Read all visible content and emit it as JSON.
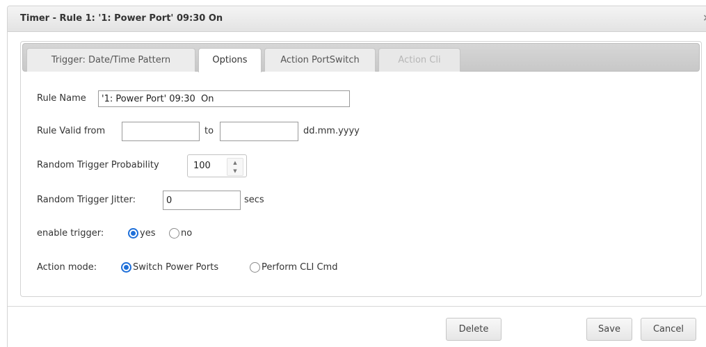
{
  "dialog": {
    "title": "Timer - Rule 1: '1: Power Port' 09:30 On",
    "close_glyph": "×"
  },
  "tabs": [
    {
      "label": "Trigger: Date/Time Pattern",
      "state": "normal"
    },
    {
      "label": "Options",
      "state": "active"
    },
    {
      "label": "Action PortSwitch",
      "state": "normal"
    },
    {
      "label": "Action Cli",
      "state": "disabled"
    }
  ],
  "form": {
    "rule_name": {
      "label": "Rule Name",
      "value": "'1: Power Port' 09:30  On"
    },
    "rule_valid": {
      "label": "Rule Valid from",
      "from_value": "",
      "to_label": "to",
      "to_value": "",
      "format_hint": "dd.mm.yyyy"
    },
    "probability": {
      "label": "Random Trigger Probability",
      "value": "100"
    },
    "jitter": {
      "label": "Random Trigger Jitter:",
      "value": "0",
      "unit": "secs"
    },
    "enable_trigger": {
      "label": "enable trigger:",
      "options": [
        "yes",
        "no"
      ],
      "selected": "yes"
    },
    "action_mode": {
      "label": "Action mode:",
      "options": [
        "Switch Power Ports",
        "Perform CLI Cmd"
      ],
      "selected": "Switch Power Ports"
    }
  },
  "buttons": {
    "delete": "Delete",
    "save": "Save",
    "cancel": "Cancel"
  },
  "colors": {
    "accent": "#1e6fd9",
    "disabled_text": "#b6b6b6"
  },
  "icons": {
    "close": "close-icon",
    "spinner_up": "chevron-up-icon",
    "spinner_down": "chevron-down-icon"
  }
}
